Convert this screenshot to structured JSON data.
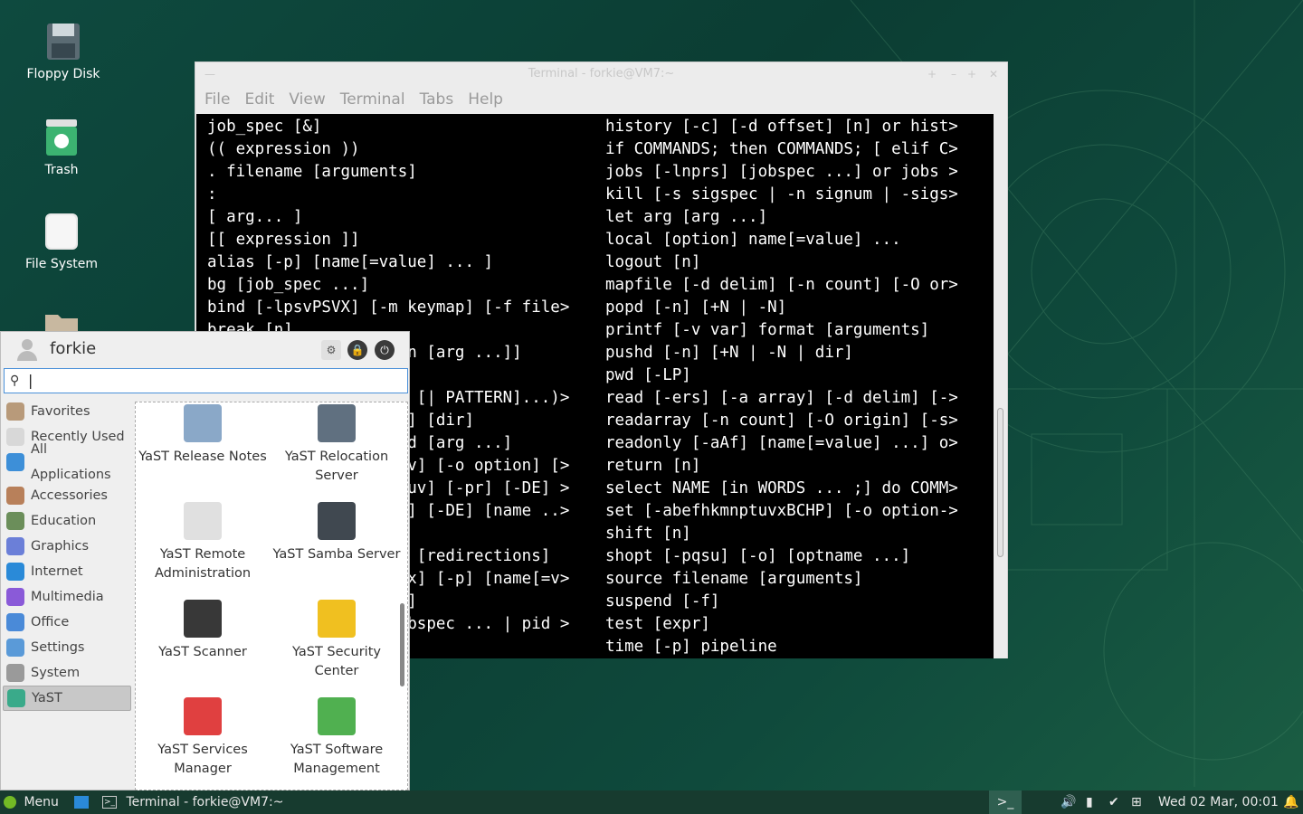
{
  "desktop": {
    "icons": [
      {
        "label": "Floppy Disk"
      },
      {
        "label": "Trash"
      },
      {
        "label": "File System"
      }
    ]
  },
  "terminal": {
    "title": "Terminal - forkie@VM7:~",
    "menu": [
      "File",
      "Edit",
      "View",
      "Terminal",
      "Tabs",
      "Help"
    ],
    "left_lines": [
      "job_spec [&]",
      "(( expression ))",
      ". filename [arguments]",
      ":",
      "[ arg... ]",
      "[[ expression ]]",
      "alias [-p] [name[=value] ... ]",
      "bg [job_spec ...]",
      "bind [-lpsvPSVX] [-m keymap] [-f file>",
      "break [n]",
      "                    in [arg ...]]",
      "",
      "                    N [| PATTERN]...)>",
      "                    ]] [dir]",
      "                    nd [arg ...]",
      "                    uv] [-o option] [>",
      "                    suv] [-pr] [-DE] >",
      "                    n] [-DE] [name ..>",
      "",
      "                    d [redirections]",
      "                    ux] [-p] [name[=v>",
      "                    N]",
      "                    obspec ... | pid >",
      "                    ]"
    ],
    "right_lines": [
      "history [-c] [-d offset] [n] or hist>",
      "if COMMANDS; then COMMANDS; [ elif C>",
      "jobs [-lnprs] [jobspec ...] or jobs >",
      "kill [-s sigspec | -n signum | -sigs>",
      "let arg [arg ...]",
      "local [option] name[=value] ...",
      "logout [n]",
      "mapfile [-d delim] [-n count] [-O or>",
      "popd [-n] [+N | -N]",
      "printf [-v var] format [arguments]",
      "pushd [-n] [+N | -N | dir]",
      "pwd [-LP]",
      "read [-ers] [-a array] [-d delim] [->",
      "readarray [-n count] [-O origin] [-s>",
      "readonly [-aAf] [name[=value] ...] o>",
      "return [n]",
      "select NAME [in WORDS ... ;] do COMM>",
      "set [-abefhkmnptuvxBCHP] [-o option->",
      "shift [n]",
      "shopt [-pqsu] [-o] [optname ...]",
      "source filename [arguments]",
      "suspend [-f]",
      "test [expr]",
      "time [-p] pipeline"
    ]
  },
  "whisker": {
    "user": "forkie",
    "search_value": "",
    "categories": [
      {
        "label": "Favorites",
        "color": "#b89a7a"
      },
      {
        "label": "Recently Used",
        "color": "#d8d8d8"
      },
      {
        "label": "All Applications",
        "color": "#3d8fd8"
      },
      {
        "label": "Accessories",
        "color": "#b8805a"
      },
      {
        "label": "Education",
        "color": "#6b8e5a"
      },
      {
        "label": "Graphics",
        "color": "#6b7fd8"
      },
      {
        "label": "Internet",
        "color": "#2a8ad8"
      },
      {
        "label": "Multimedia",
        "color": "#8a5ad8"
      },
      {
        "label": "Office",
        "color": "#4a8ad8"
      },
      {
        "label": "Settings",
        "color": "#5a9ad8"
      },
      {
        "label": "System",
        "color": "#9a9a9a"
      },
      {
        "label": "YaST",
        "color": "#3aaa8a"
      }
    ],
    "apps": [
      {
        "label": "YaST Release Notes",
        "icon": "release-notes-icon"
      },
      {
        "label": "YaST Relocation Server",
        "icon": "relocation-server-icon"
      },
      {
        "label": "YaST Remote Administration",
        "icon": "remote-admin-icon"
      },
      {
        "label": "YaST Samba Server",
        "icon": "samba-server-icon"
      },
      {
        "label": "YaST Scanner",
        "icon": "scanner-icon"
      },
      {
        "label": "YaST Security Center",
        "icon": "security-center-icon"
      },
      {
        "label": "YaST Services Manager",
        "icon": "services-manager-icon"
      },
      {
        "label": "YaST Software Management",
        "icon": "software-management-icon"
      }
    ]
  },
  "taskbar": {
    "menu_label": "Menu",
    "window_label": "Terminal - forkie@VM7:~",
    "clock": "Wed 02 Mar, 00:01"
  }
}
